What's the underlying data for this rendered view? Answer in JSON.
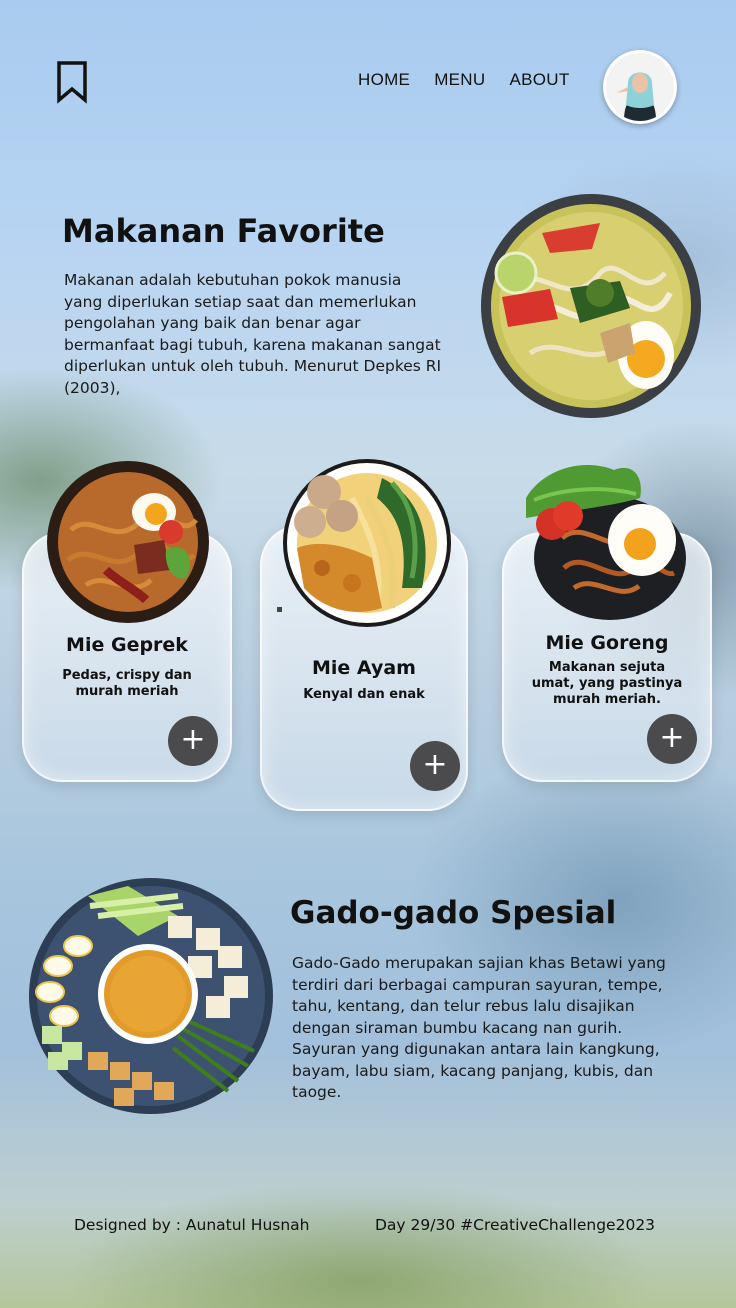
{
  "header": {
    "nav": [
      "HOME",
      "MENU",
      "ABOUT"
    ]
  },
  "hero": {
    "title": "Makanan Favorite",
    "text": "Makanan adalah kebutuhan pokok manusia yang diperlukan setiap saat dan memerlukan pengolahan yang baik dan benar agar bermanfaat bagi tubuh, karena makanan sangat diperlukan untuk oleh tubuh. Menurut Depkes RI (2003),"
  },
  "cards": [
    {
      "title": "Mie Geprek",
      "desc": "Pedas, crispy dan murah meriah",
      "add": "+"
    },
    {
      "title": "Mie Ayam",
      "desc": "Kenyal dan enak",
      "add": "+"
    },
    {
      "title": "Mie Goreng",
      "desc": "Makanan sejuta umat, yang pastinya murah meriah.",
      "add": "+"
    }
  ],
  "feature": {
    "title": "Gado-gado Spesial",
    "text": "Gado-Gado merupakan sajian khas Betawi yang terdiri dari berbagai campuran sayuran, tempe, tahu, kentang, dan telur rebus lalu disajikan dengan siraman bumbu kacang nan gurih. Sayuran yang digunakan antara lain kangkung, bayam, labu siam, kacang panjang, kubis, dan taoge."
  },
  "footer": {
    "designer": "Designed by : Aunatul Husnah",
    "challenge": "Day 29/30 #CreativeChallenge2023"
  },
  "colors": {
    "add_button": "#4b4b4d",
    "text": "#111111"
  }
}
